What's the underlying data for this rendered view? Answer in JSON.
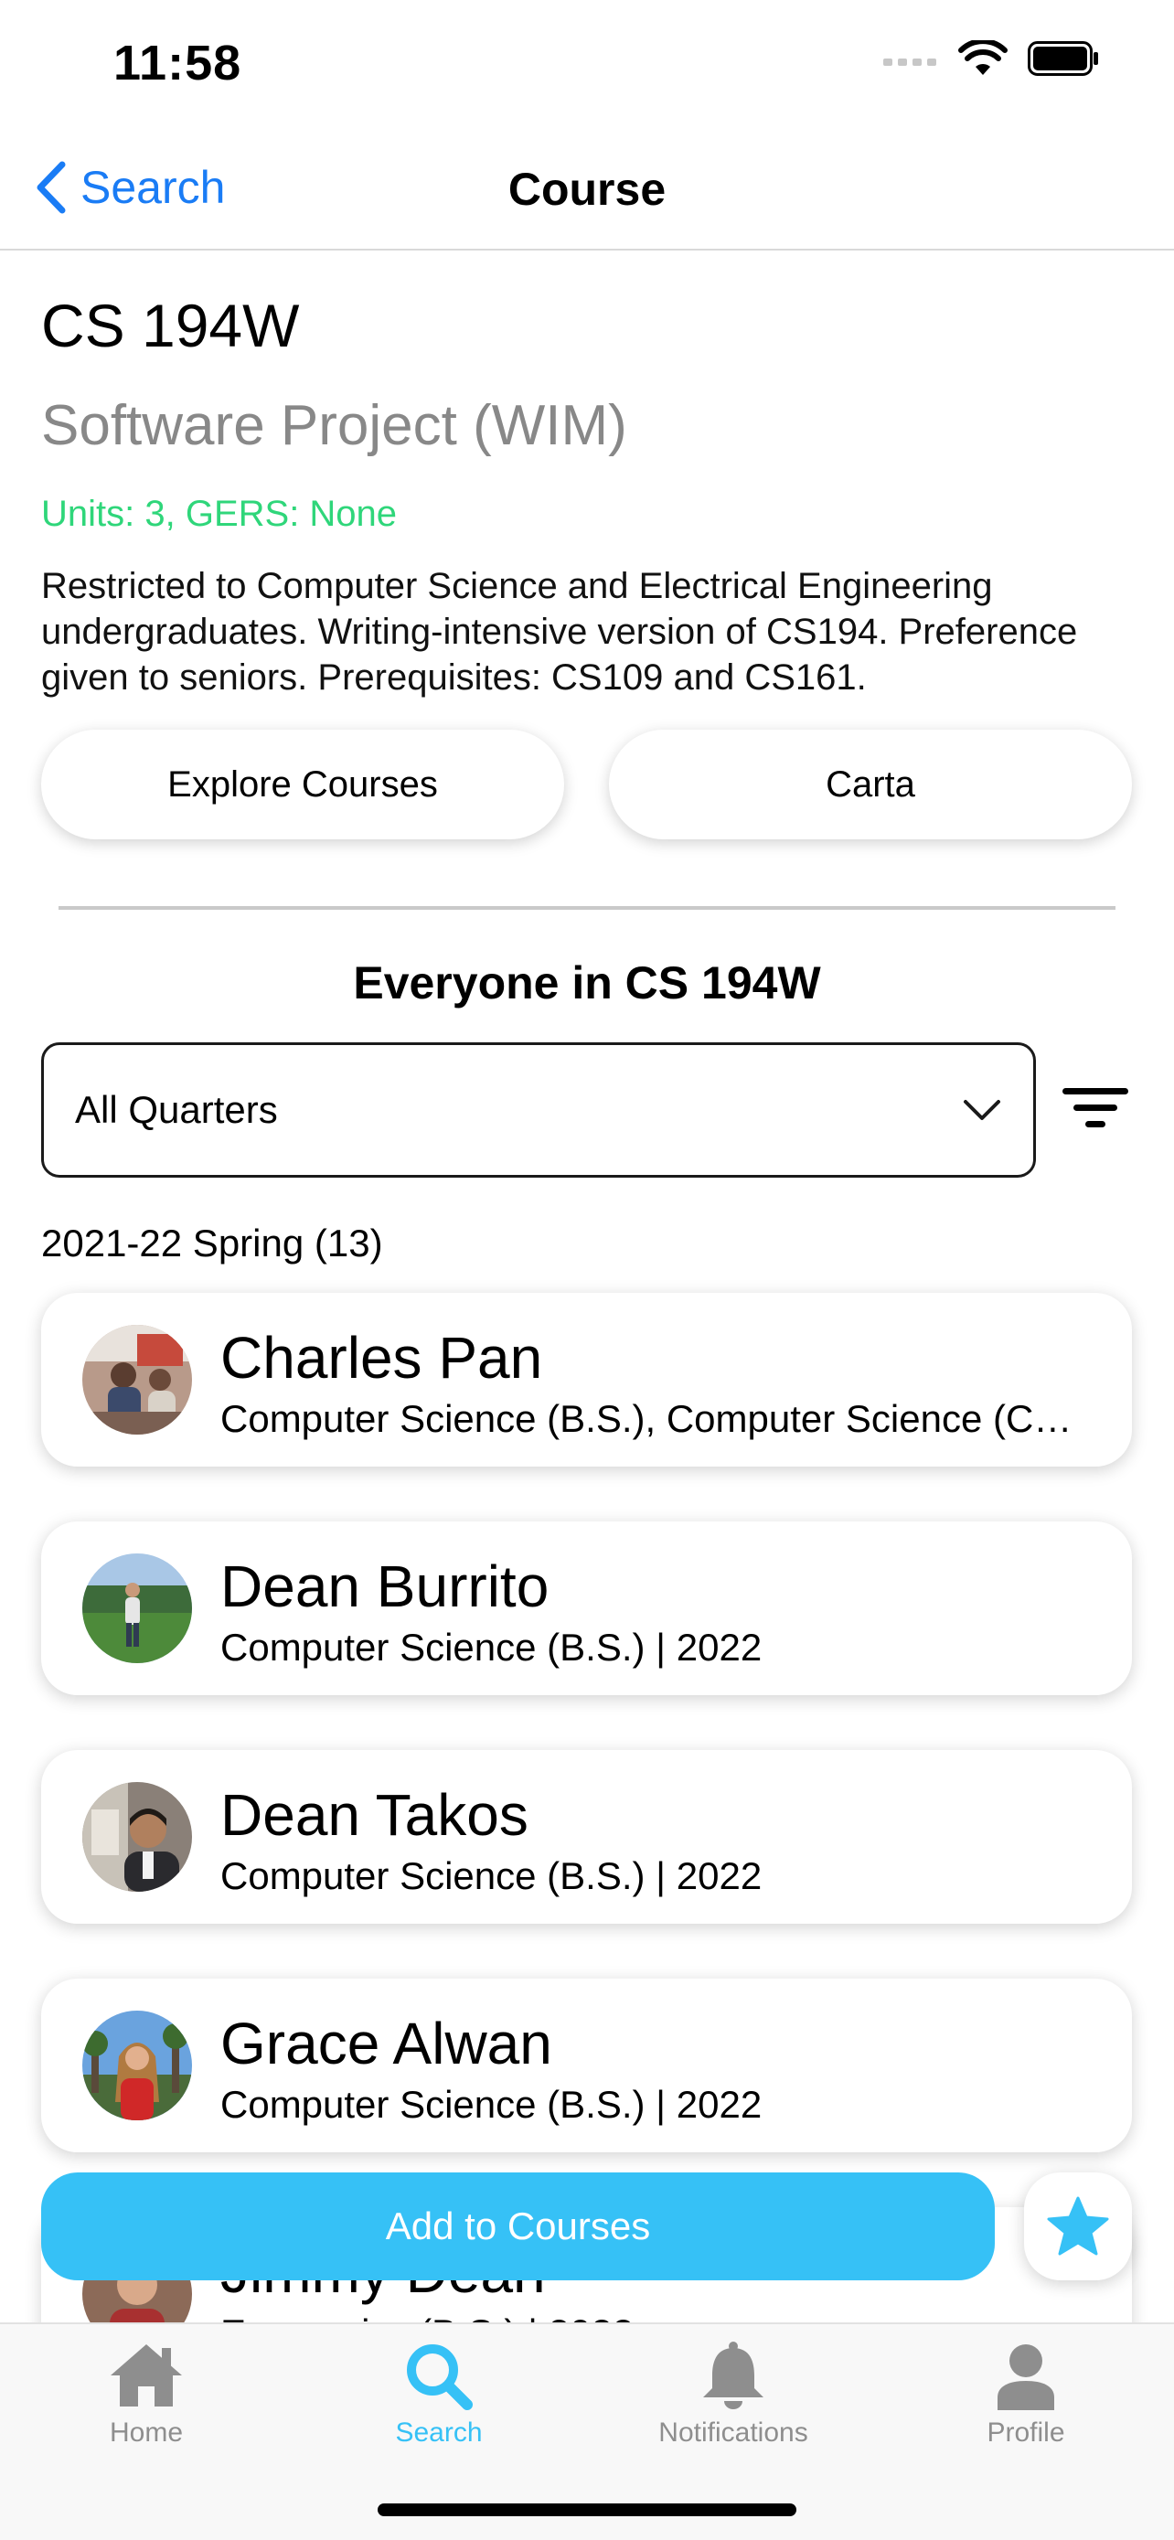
{
  "status": {
    "time": "11:58"
  },
  "nav": {
    "back_label": "Search",
    "title": "Course"
  },
  "course": {
    "code": "CS 194W",
    "name": "Software Project (WIM)",
    "units": "Units: 3, GERS: None",
    "description": "Restricted to Computer Science and Electrical Engineering undergraduates.  Writing-intensive version of CS194. Preference given to seniors. Prerequisites: CS109 and CS161.",
    "buttons": {
      "explore": "Explore Courses",
      "carta": "Carta"
    }
  },
  "section": {
    "title": "Everyone in CS 194W",
    "quarter_select": "All Quarters",
    "group_header": "2021-22 Spring (13)"
  },
  "people": [
    {
      "name": "Charles Pan",
      "major": "Computer Science (B.S.), Computer Science (C…"
    },
    {
      "name": "Dean Burrito",
      "major": "Computer Science (B.S.) | 2022"
    },
    {
      "name": "Dean Takos",
      "major": "Computer Science (B.S.) | 2022"
    },
    {
      "name": "Grace Alwan",
      "major": "Computer Science (B.S.) | 2022"
    },
    {
      "name": "Jimmy Dean",
      "major": "Economics (B.S.) | 2022"
    }
  ],
  "actions": {
    "add_to_courses": "Add to Courses"
  },
  "tabs": [
    {
      "label": "Home",
      "icon": "house-icon"
    },
    {
      "label": "Search",
      "icon": "search-icon"
    },
    {
      "label": "Notifications",
      "icon": "bell-icon"
    },
    {
      "label": "Profile",
      "icon": "person-icon"
    }
  ],
  "colors": {
    "accent": "#36c1f6",
    "link": "#1a7cf5",
    "units_green": "#2fd67a",
    "tab_inactive": "#8e8e8e"
  }
}
